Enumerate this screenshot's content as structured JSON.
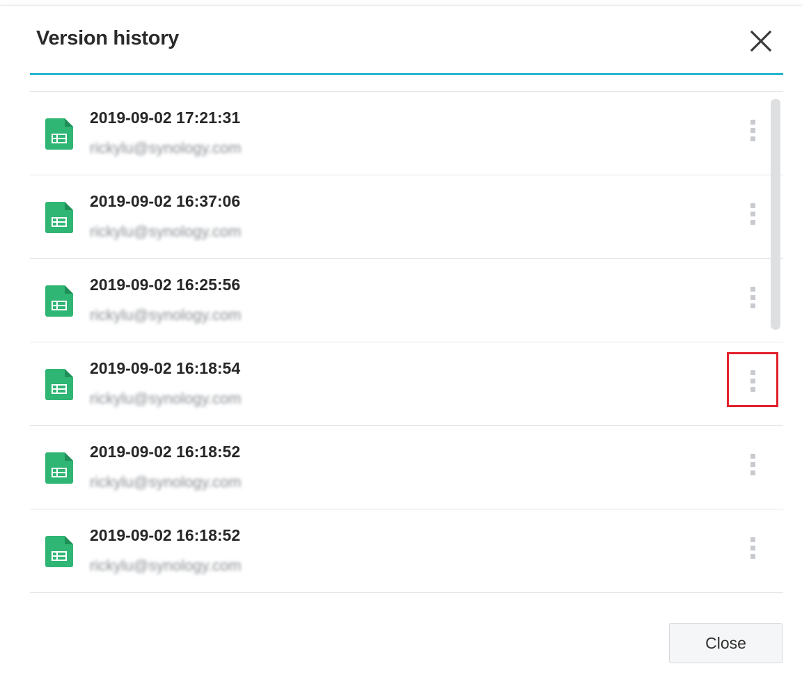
{
  "dialog": {
    "title": "Version history",
    "close_button_label": "Close"
  },
  "versions": [
    {
      "time": "2019-09-02 17:21:31",
      "user": "rickylu@synology.com"
    },
    {
      "time": "2019-09-02 16:37:06",
      "user": "rickylu@synology.com"
    },
    {
      "time": "2019-09-02 16:25:56",
      "user": "rickylu@synology.com"
    },
    {
      "time": "2019-09-02 16:18:54",
      "user": "rickylu@synology.com"
    },
    {
      "time": "2019-09-02 16:18:52",
      "user": "rickylu@synology.com"
    },
    {
      "time": "2019-09-02 16:18:52",
      "user": "rickylu@synology.com"
    }
  ],
  "icons": {
    "close": "close-icon",
    "file": "spreadsheet-file-icon",
    "more": "more-vertical-icon"
  },
  "colors": {
    "accent": "#25b7cf",
    "file_icon": "#2fb574",
    "highlight": "#e3202a"
  },
  "highlighted_version_index": 3
}
